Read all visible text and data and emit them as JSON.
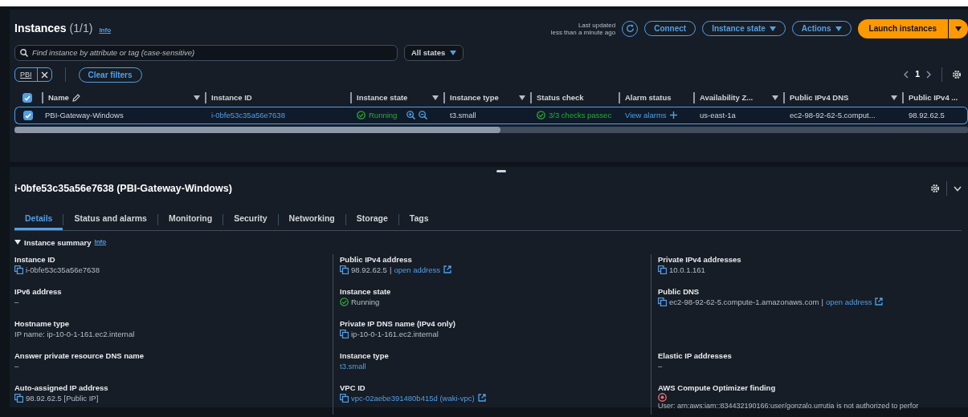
{
  "header": {
    "title": "Instances",
    "count": "(1/1)",
    "info": "Info",
    "last_updated": [
      "Last updated",
      "less than a minute ago"
    ],
    "buttons": [
      {
        "label": "Connect",
        "kind": "outline",
        "caret": false
      },
      {
        "label": "Instance state",
        "kind": "outline",
        "caret": true
      },
      {
        "label": "Actions",
        "kind": "outline",
        "caret": true
      },
      {
        "label": "Launch instances",
        "kind": "primary",
        "caret": true
      }
    ]
  },
  "search": {
    "placeholder": "Find instance by attribute or tag (case-sensitive)"
  },
  "state_filter": {
    "label": "All states"
  },
  "filters": [
    {
      "label": "PBI"
    }
  ],
  "clear_filters": "Clear filters",
  "pagination": {
    "pages": [
      {
        "label": "1",
        "selected": true
      }
    ]
  },
  "table": {
    "all_checked": true,
    "columns": [
      {
        "label": "Name",
        "editable": true,
        "sortable": true
      },
      {
        "label": "Instance ID",
        "editable": false,
        "sortable": false
      },
      {
        "label": "Instance state",
        "editable": false,
        "sortable": true
      },
      {
        "label": "Instance type",
        "editable": false,
        "sortable": true
      },
      {
        "label": "Status check",
        "editable": false,
        "sortable": false
      },
      {
        "label": "Alarm status",
        "editable": false,
        "sortable": false
      },
      {
        "label": "Availability Z...",
        "editable": false,
        "sortable": true
      },
      {
        "label": "Public IPv4 DNS",
        "editable": false,
        "sortable": true
      },
      {
        "label": "Public IPv4 ...",
        "editable": false,
        "sortable": false
      }
    ],
    "rows": [
      {
        "checked": true,
        "selected": true,
        "cells": [
          {
            "kind": "text",
            "text": "PBI-Gateway-Windows"
          },
          {
            "kind": "link",
            "text": "i-0bfe53c35a56e7638"
          },
          {
            "kind": "state",
            "text": "Running"
          },
          {
            "kind": "text",
            "text": "t3.small"
          },
          {
            "kind": "ok",
            "text": "3/3 checks passec"
          },
          {
            "kind": "add_link",
            "text": "View alarms"
          },
          {
            "kind": "text",
            "text": "us-east-1a"
          },
          {
            "kind": "text",
            "text": "ec2-98-92-62-5.comput..."
          },
          {
            "kind": "text",
            "text": "98.92.62.5"
          }
        ]
      }
    ]
  },
  "details": {
    "title": "i-0bfe53c35a56e7638 (PBI-Gateway-Windows)",
    "tabs": [
      {
        "label": "Details",
        "selected": true
      },
      {
        "label": "Status and alarms",
        "selected": false
      },
      {
        "label": "Monitoring",
        "selected": false
      },
      {
        "label": "Security",
        "selected": false
      },
      {
        "label": "Networking",
        "selected": false
      },
      {
        "label": "Storage",
        "selected": false
      },
      {
        "label": "Tags",
        "selected": false
      }
    ],
    "section": {
      "title": "Instance summary",
      "info": "Info",
      "expanded": true,
      "rows": [
        [
          {
            "label": "Instance ID",
            "kind": "copy",
            "value": "i-0bfe53c35a56e7638"
          },
          {
            "label": "Public IPv4 address",
            "kind": "copy_link",
            "value": "98.92.62.5",
            "separator": "|",
            "link": "open address"
          },
          {
            "label": "Private IPv4 addresses",
            "kind": "copy",
            "value": "10.0.1.161"
          }
        ],
        [
          {
            "label": "IPv6 address",
            "kind": "text",
            "value": "–"
          },
          {
            "label": "Instance state",
            "kind": "status",
            "value": "Running"
          },
          {
            "label": "Public DNS",
            "kind": "copy_link",
            "value": "ec2-98-92-62-5.compute-1.amazonaws.com",
            "separator": "|",
            "link": "open address"
          }
        ],
        [
          {
            "label": "Hostname type",
            "kind": "text",
            "value": "IP name: ip-10-0-1-161.ec2.internal"
          },
          {
            "label": "Private IP DNS name (IPv4 only)",
            "kind": "copy",
            "value": "ip-10-0-1-161.ec2.internal"
          },
          null
        ],
        [
          {
            "label": "Answer private resource DNS name",
            "kind": "text",
            "value": "–"
          },
          {
            "label": "Instance type",
            "kind": "link",
            "value": "t3.small"
          },
          {
            "label": "Elastic IP addresses",
            "kind": "text",
            "value": "–"
          }
        ],
        [
          {
            "label": "Auto-assigned IP address",
            "kind": "copy",
            "value": "98.92.62.5 [Public IP]"
          },
          {
            "label": "VPC ID",
            "kind": "copy_ext",
            "value": "vpc-02aebe391480b415d (waki-vpc)"
          },
          {
            "label": "AWS Compute Optimizer finding",
            "kind": "error",
            "value": "User: arn:aws:iam::834432190166:user/gonzalo.urrutia is not authorized to perfor"
          }
        ]
      ]
    }
  }
}
